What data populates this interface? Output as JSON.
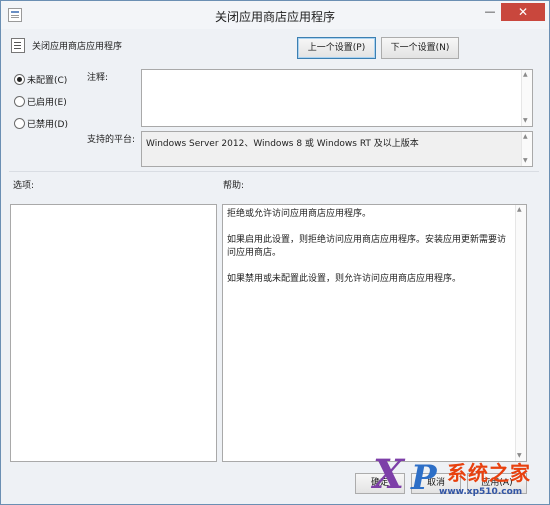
{
  "window": {
    "title": "关闭应用商店应用程序",
    "minimize_glyph": "—",
    "close_glyph": "✕"
  },
  "policy": {
    "name": "关闭应用商店应用程序"
  },
  "nav": {
    "prev_label": "上一个设置(P)",
    "next_label": "下一个设置(N)"
  },
  "state": {
    "options": [
      {
        "label": "未配置(C)",
        "checked": true
      },
      {
        "label": "已启用(E)",
        "checked": false
      },
      {
        "label": "已禁用(D)",
        "checked": false
      }
    ]
  },
  "comment": {
    "label": "注释:",
    "value": ""
  },
  "platform": {
    "label": "支持的平台:",
    "value": "Windows Server 2012、Windows 8 或 Windows RT 及以上版本"
  },
  "sections": {
    "options_label": "选项:",
    "help_label": "帮助:"
  },
  "help": {
    "paragraphs": [
      "拒绝或允许访问应用商店应用程序。",
      "如果启用此设置，则拒绝访问应用商店应用程序。安装应用更新需要访问应用商店。",
      "如果禁用或未配置此设置，则允许访问应用商店应用程序。"
    ]
  },
  "buttons": {
    "ok": "确定",
    "cancel": "取消",
    "apply": "应用(A)"
  },
  "watermark": {
    "letter_x": "X",
    "letter_p": "P",
    "text": "系统之家",
    "url": "www.xp510.com"
  },
  "colors": {
    "accent": "#3c7fb1",
    "close_button": "#c9473d"
  }
}
